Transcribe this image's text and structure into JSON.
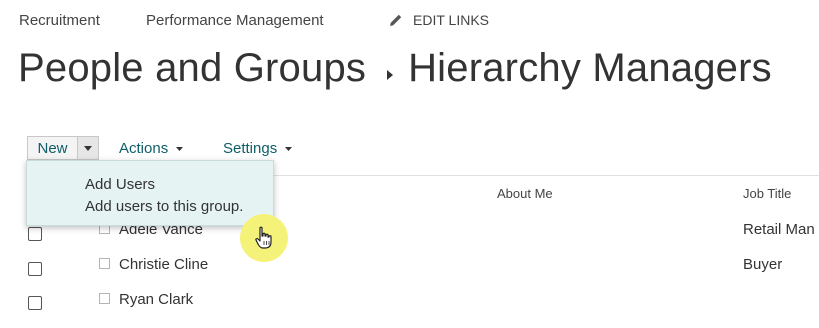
{
  "top_links": {
    "recruitment": "Recruitment",
    "performance": "Performance Management",
    "edit_links": "EDIT LINKS"
  },
  "page_title": {
    "part1": "People and Groups",
    "part2": "Hierarchy Managers"
  },
  "toolbar": {
    "new_label": "New",
    "actions_label": "Actions",
    "settings_label": "Settings"
  },
  "new_menu": {
    "item_title": "Add Users",
    "item_description": "Add users to this group."
  },
  "columns": {
    "about": "About Me",
    "job": "Job Title"
  },
  "rows": [
    {
      "name": "Adele Vance",
      "job": "Retail Man"
    },
    {
      "name": "Christie Cline",
      "job": "Buyer"
    },
    {
      "name": "Ryan Clark",
      "job": ""
    }
  ],
  "colors": {
    "link_accent": "#0f5e68",
    "menu_highlight": "#e5f3f3",
    "cursor_highlight": "#f5f27a"
  },
  "icons": [
    "pencil-icon",
    "chevron-right-icon",
    "caret-down-icon",
    "hand-pointer-icon"
  ]
}
